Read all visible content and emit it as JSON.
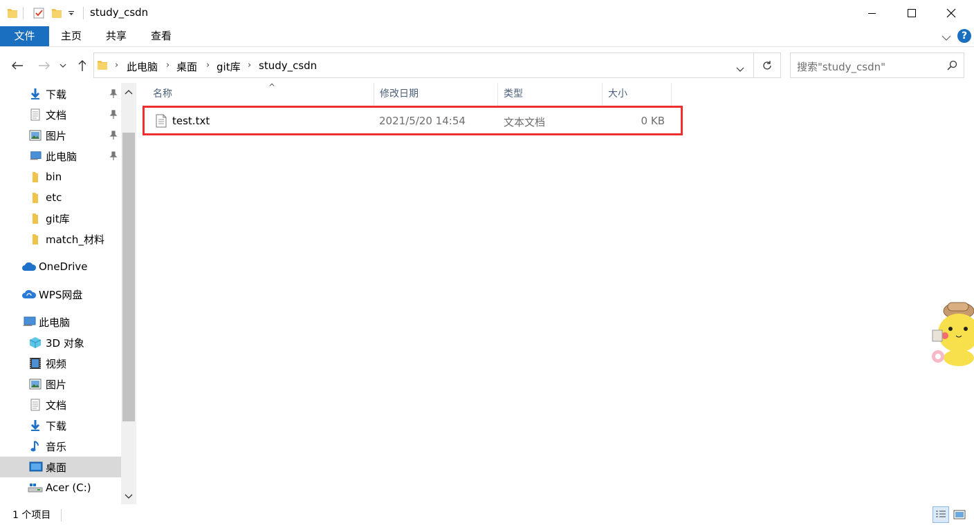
{
  "window": {
    "title": "study_csdn"
  },
  "ribbon": {
    "tabs": [
      "文件",
      "主页",
      "共享",
      "查看"
    ]
  },
  "address": {
    "crumbs": [
      "此电脑",
      "桌面",
      "git库",
      "study_csdn"
    ],
    "search_placeholder": "搜索\"study_csdn\""
  },
  "nav": {
    "items": [
      {
        "label": "下载",
        "icon": "download-icon",
        "pinned": true
      },
      {
        "label": "文档",
        "icon": "document-icon",
        "pinned": true
      },
      {
        "label": "图片",
        "icon": "picture-icon",
        "pinned": true
      },
      {
        "label": "此电脑",
        "icon": "computer-icon",
        "pinned": true
      },
      {
        "label": "bin",
        "icon": "folder-icon"
      },
      {
        "label": "etc",
        "icon": "folder-icon"
      },
      {
        "label": "git库",
        "icon": "folder-icon"
      },
      {
        "label": "match_材料",
        "icon": "folder-icon"
      },
      {
        "label": "OneDrive",
        "icon": "onedrive-icon"
      },
      {
        "label": "WPS网盘",
        "icon": "wps-cloud-icon"
      },
      {
        "label": "此电脑",
        "icon": "computer-icon"
      },
      {
        "label": "3D 对象",
        "icon": "3d-objects-icon"
      },
      {
        "label": "视频",
        "icon": "video-icon"
      },
      {
        "label": "图片",
        "icon": "picture-icon"
      },
      {
        "label": "文档",
        "icon": "document-icon"
      },
      {
        "label": "下载",
        "icon": "download-icon"
      },
      {
        "label": "音乐",
        "icon": "music-icon"
      },
      {
        "label": "桌面",
        "icon": "desktop-icon",
        "selected": true
      },
      {
        "label": "Acer (C:)",
        "icon": "drive-icon"
      }
    ]
  },
  "columns": [
    "名称",
    "修改日期",
    "类型",
    "大小"
  ],
  "files": [
    {
      "name": "test.txt",
      "modified": "2021/5/20 14:54",
      "type": "文本文档",
      "size": "0 KB"
    }
  ],
  "status": {
    "item_count": "1 个项目"
  },
  "colors": {
    "accent": "#1a6fc0",
    "highlight_border": "#ef2e2e",
    "selected_bg": "#d9d9d9"
  }
}
